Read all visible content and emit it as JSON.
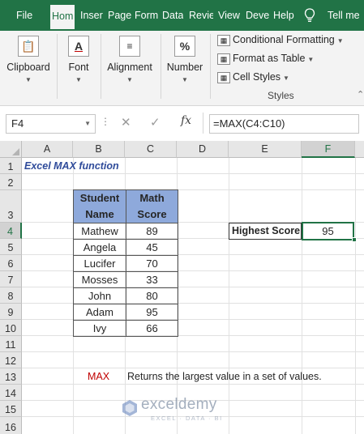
{
  "tabs": [
    {
      "label": "File",
      "active": false
    },
    {
      "label": "Hom",
      "active": true
    },
    {
      "label": "Inser",
      "active": false
    },
    {
      "label": "Page",
      "active": false
    },
    {
      "label": "Form",
      "active": false
    },
    {
      "label": "Data",
      "active": false
    },
    {
      "label": "Revie",
      "active": false
    },
    {
      "label": "View",
      "active": false
    },
    {
      "label": "Deve",
      "active": false
    },
    {
      "label": "Help",
      "active": false
    }
  ],
  "tell_me": "Tell me",
  "ribbon": {
    "clipboard": "Clipboard",
    "font": "Font",
    "alignment": "Alignment",
    "number": "Number",
    "conditional_formatting": "Conditional Formatting",
    "format_as_table": "Format as Table",
    "cell_styles": "Cell Styles",
    "styles": "Styles"
  },
  "name_box": "F4",
  "formula": "=MAX(C4:C10)",
  "columns": [
    "A",
    "B",
    "C",
    "D",
    "E",
    "F"
  ],
  "selected_column": "F",
  "rows": [
    "1",
    "2",
    "3",
    "4",
    "5",
    "6",
    "7",
    "8",
    "9",
    "10",
    "11",
    "12",
    "13",
    "14",
    "15",
    "16"
  ],
  "selected_row": "4",
  "sheet": {
    "title": "Excel MAX function",
    "table_headers": [
      "Student Name",
      "Math Score"
    ],
    "table_rows": [
      [
        "Mathew",
        "89"
      ],
      [
        "Angela",
        "45"
      ],
      [
        "Lucifer",
        "70"
      ],
      [
        "Mosses",
        "33"
      ],
      [
        "John",
        "80"
      ],
      [
        "Adam",
        "95"
      ],
      [
        "Ivy",
        "66"
      ]
    ],
    "highest_label": "Highest Score",
    "highest_value": "95",
    "func_name": "MAX",
    "func_desc": "Returns the largest value in a set of values."
  },
  "watermark": {
    "name": "exceldemy",
    "tagline": "EXCEL · DATA · BI"
  },
  "colors": {
    "accent": "#217346",
    "header_fill": "#8ea9db",
    "title": "#2f4b9a",
    "func": "#c00000"
  }
}
